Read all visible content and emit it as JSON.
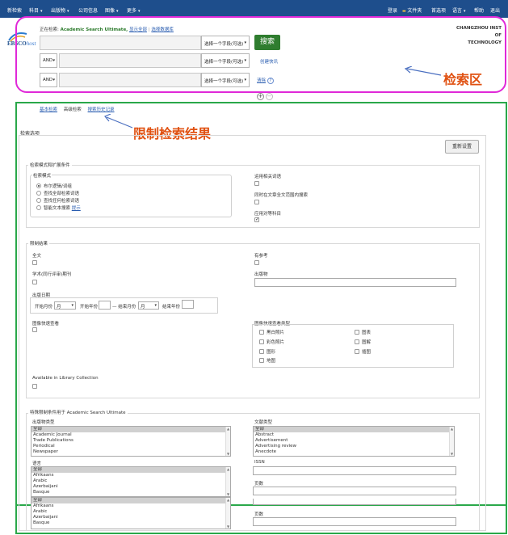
{
  "topnav": {
    "left": [
      {
        "label": "新检索",
        "caret": false
      },
      {
        "label": "科目",
        "caret": true
      },
      {
        "label": "出版物",
        "caret": true
      },
      {
        "label": "公司信息",
        "caret": false
      },
      {
        "label": "图像",
        "caret": true
      },
      {
        "label": "更多",
        "caret": true
      }
    ],
    "right": [
      "登录",
      "文件夹",
      "首选项",
      "语言",
      "帮助",
      "退出"
    ]
  },
  "search": {
    "searching_label": "正在检索:",
    "database": "Academic Search Ultimate,",
    "show_all": "显示全部",
    "choose_db": "选择数据库",
    "logo_ebsco": "EBSCO",
    "logo_host": "host",
    "institution_line1": "CHANGZHOU INST OF",
    "institution_line2": "TECHNOLOGY",
    "field_select": "选择一个字段(可选)",
    "bool_and": "AND",
    "search_button": "搜索",
    "create_alert": "创建快讯",
    "clear": "清除",
    "help": "?",
    "add_row": "+",
    "remove_row": "−"
  },
  "subtabs": {
    "basic": "基本检索",
    "advanced": "高级检索",
    "history": "搜索历史记录"
  },
  "annotations": {
    "search_area": "检索区",
    "limit_results": "限制检索结果"
  },
  "options": {
    "title": "检索选项",
    "reset": "重新设置",
    "modes_section": "检索模式和扩展条件",
    "search_modes_label": "检索模式",
    "modes": [
      "布尔逻辑/词组",
      "查找全部检索词语",
      "查找任何检索词语",
      "智能文本搜索"
    ],
    "hint": "提示",
    "apply_related": "运用相关词语",
    "also_fulltext": "同时在文章全文范围内搜索",
    "apply_equivalent": "应用对等科目",
    "limit_section": "限制结果",
    "full_text": "全文",
    "references": "有参考",
    "scholarly": "学术(同行评审)期刊",
    "publication": "出版物",
    "pub_date": "出版日期",
    "start_month": "开始月份",
    "month": "月",
    "start_year": "开始年份",
    "end_month": "— 结束月份",
    "end_year": "结束年份",
    "image_quick": "图像快速查看",
    "image_types_label": "图像快速查看类型",
    "image_types_left": [
      "黑白照片",
      "彩色照片",
      "图形",
      "地图"
    ],
    "image_types_right": [
      "图表",
      "图解",
      "插图"
    ],
    "library_collection": "Available in Library Collection",
    "special_section": "特殊限制条件用于 Academic Search Ultimate",
    "pubtype_label": "出版物类型",
    "pubtypes": [
      "全部",
      "Academic Journal",
      "Trade Publications",
      "Periodical",
      "Newspaper"
    ],
    "doctype_label": "文献类型",
    "doctypes": [
      "全部",
      "Abstract",
      "Advertisement",
      "Advertising review",
      "Anecdote"
    ],
    "language_label": "语言",
    "languages": [
      "全部",
      "Afrikaans",
      "Arabic",
      "Azerbaijani",
      "Basque"
    ],
    "issn_label": "ISSN",
    "pages_label": "页数",
    "pages_label2": "页数"
  }
}
